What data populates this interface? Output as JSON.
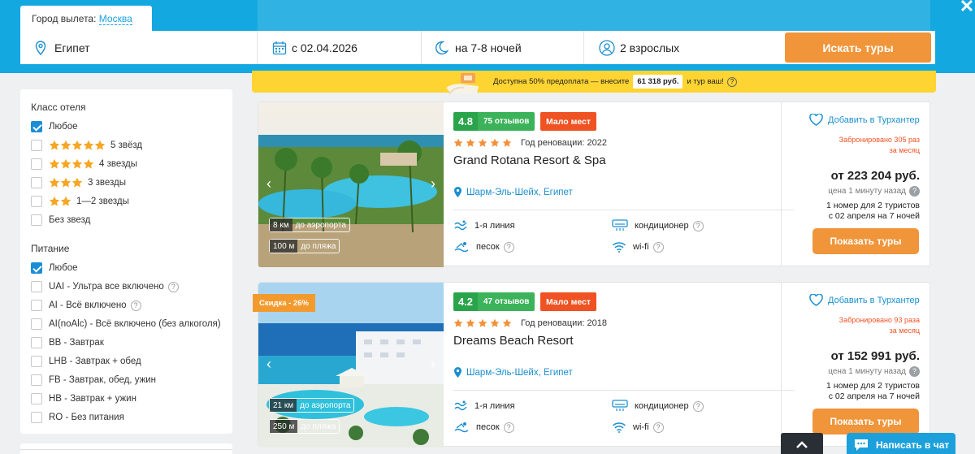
{
  "header": {
    "departure_city_label": "Город вылета:",
    "departure_city": "Москва",
    "close_symbol": "✕"
  },
  "search": {
    "country": "Египет",
    "date": "с 02.04.2026",
    "nights": "на 7-8 ночей",
    "guests": "2 взрослых",
    "button": "Искать туры"
  },
  "promo": {
    "text_before": "Доступна 50% предоплата — внесите",
    "amount": "61 318 руб.",
    "text_after": "и тур ваш!",
    "help": "?"
  },
  "filters": {
    "hotel_class_title": "Класс отеля",
    "hotel_class": [
      {
        "label": "Любое",
        "stars": 0,
        "checked": true
      },
      {
        "label": "5 звёзд",
        "stars": 5,
        "checked": false
      },
      {
        "label": "4 звезды",
        "stars": 4,
        "checked": false
      },
      {
        "label": "3 звезды",
        "stars": 3,
        "checked": false
      },
      {
        "label": "1—2 звезды",
        "stars": 2,
        "checked": false
      },
      {
        "label": "Без звезд",
        "stars": 0,
        "checked": false
      }
    ],
    "meals_title": "Питание",
    "meals": [
      {
        "label": "Любое",
        "checked": true,
        "help": false
      },
      {
        "label": "UAI - Ультра все включено",
        "checked": false,
        "help": true
      },
      {
        "label": "AI - Всё включено",
        "checked": false,
        "help": true
      },
      {
        "label": "AI(noAlc) - Всё включено (без алкоголя)",
        "checked": false,
        "help": false
      },
      {
        "label": "BB - Завтрак",
        "checked": false,
        "help": false
      },
      {
        "label": "LHB - Завтрак + обед",
        "checked": false,
        "help": false
      },
      {
        "label": "FB - Завтрак, обед, ужин",
        "checked": false,
        "help": false
      },
      {
        "label": "HB - Завтрак + ужин",
        "checked": false,
        "help": false
      },
      {
        "label": "RO - Без питания",
        "checked": false,
        "help": false
      }
    ]
  },
  "hotels": [
    {
      "score": "4.8",
      "reviews": "75 отзывов",
      "hot_badge": "Мало мест",
      "stars": 5,
      "renovation": "Год реновации: 2022",
      "name": "Grand Rotana Resort & Spa",
      "location": "Шарм-Эль-Шейх, Египет",
      "airport_km": "8 км",
      "airport_label": "до аэропорта",
      "beach_m": "100 м",
      "beach_label": "до пляжа",
      "discount": "",
      "features": {
        "line": "1-я линия",
        "ac": "кондиционер",
        "sand": "песок",
        "wifi": "wi-fi"
      },
      "favorite": "Добавить в Турхантер",
      "booked_line1": "Забронировано 305 раз",
      "booked_line2": "за месяц",
      "price": "от 223 204 руб.",
      "updated": "цена 1 минуту назад",
      "rooms_line1": "1 номер для 2 туристов",
      "rooms_line2": "с 02 апреля на 7 ночей",
      "button": "Показать туры"
    },
    {
      "score": "4.2",
      "reviews": "47 отзывов",
      "hot_badge": "Мало мест",
      "stars": 5,
      "renovation": "Год реновации: 2018",
      "name": "Dreams Beach Resort",
      "location": "Шарм-Эль-Шейх, Египет",
      "airport_km": "21 км",
      "airport_label": "до аэропорта",
      "beach_m": "250 м",
      "beach_label": "до пляжа",
      "discount": "Скидка - 26%",
      "features": {
        "line": "1-я линия",
        "ac": "кондиционер",
        "sand": "песок",
        "wifi": "wi-fi"
      },
      "favorite": "Добавить в Турхантер",
      "booked_line1": "Забронировано 93 раза",
      "booked_line2": "за месяц",
      "price": "от 152 991 руб.",
      "updated": "цена 1 минуту назад",
      "rooms_line1": "1 номер для 2 туристов",
      "rooms_line2": "с 02 апреля на 7 ночей",
      "button": "Показать туры"
    }
  ],
  "chat": {
    "label": "Написать в чат"
  },
  "colors": {
    "header_blue": "#14a8e0",
    "accent_orange": "#f0953a",
    "promo_yellow": "#fdd431",
    "rating_green": "#2aa44a",
    "hot_red": "#ef5223",
    "link_blue": "#1a8fd0"
  }
}
